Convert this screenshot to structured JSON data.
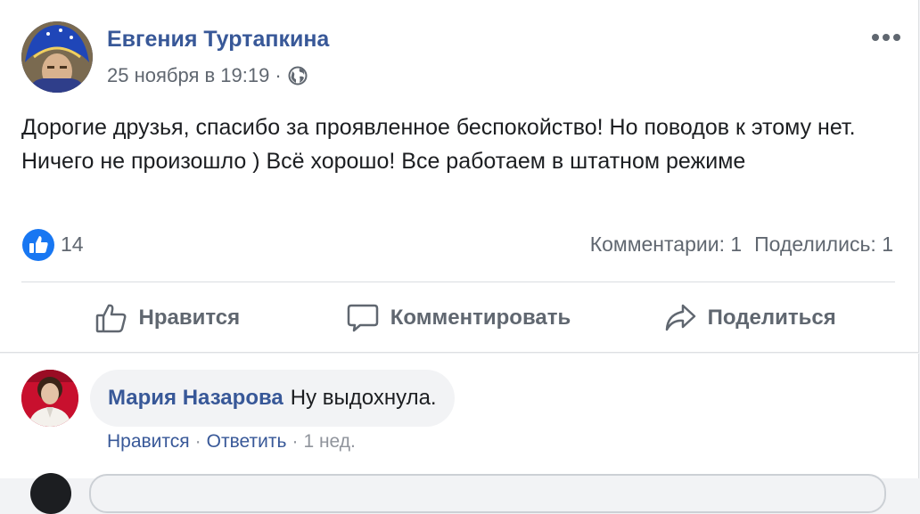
{
  "post": {
    "author": "Евгения Туртапкина",
    "date": "25 ноября в 19:19",
    "meta_separator": "·",
    "text": "Дорогие друзья, спасибо за проявленное беспокойство! Но поводов к этому нет. Ничего не произошло ) Всё хорошо! Все работаем в штатном режиме",
    "like_count": "14",
    "comments_count": "Комментарии: 1",
    "shares_count": "Поделились: 1"
  },
  "actions": {
    "like": "Нравится",
    "comment": "Комментировать",
    "share": "Поделиться"
  },
  "comment": {
    "author": "Мария Назарова",
    "text": "Ну выдохнула.",
    "like": "Нравится",
    "reply": "Ответить",
    "separator": "·",
    "time": "1 нед."
  },
  "icons": {
    "privacy": "globe-icon",
    "menu": "more-icon",
    "reaction": "thumbs-up-icon",
    "like_action": "thumbs-up-outline-icon",
    "comment_action": "speech-bubble-icon",
    "share_action": "share-arrow-icon"
  },
  "colors": {
    "link_blue": "#385898",
    "like_blue": "#1877f2",
    "secondary_text": "#606770",
    "bubble_bg": "#f2f3f5"
  }
}
